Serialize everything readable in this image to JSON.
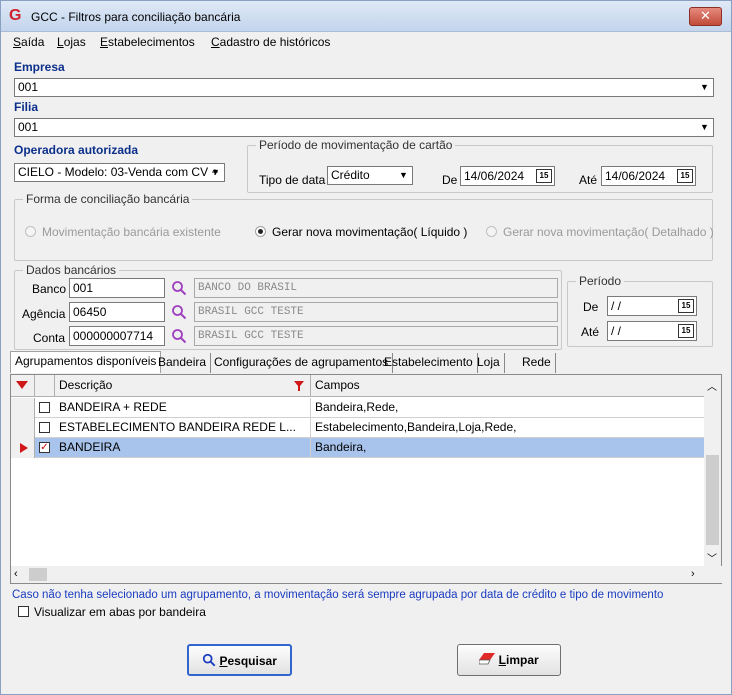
{
  "window": {
    "title": "GCC - Filtros para conciliação bancária",
    "close_label": "✕"
  },
  "menu": {
    "items": [
      {
        "accel": "S",
        "rest": "aída"
      },
      {
        "accel": "L",
        "rest": "ojas"
      },
      {
        "accel": "E",
        "rest": "stabelecimentos"
      },
      {
        "accel": "C",
        "rest": "adastro de históricos"
      }
    ]
  },
  "empresa": {
    "label": "Empresa",
    "value": "001"
  },
  "filial": {
    "label": "Filia",
    "value": "001"
  },
  "operadora": {
    "label": "Operadora autorizada",
    "value": "CIELO - Modelo: 03-Venda com CV +"
  },
  "periodo_cartao": {
    "title": "Período de movimentação de cartão",
    "tipo_label": "Tipo de data",
    "tipo_value": "Crédito",
    "de_label": "De",
    "de_value": "14/06/2024",
    "ate_label": "Até",
    "ate_value": "14/06/2024",
    "cal_glyph": "15"
  },
  "forma": {
    "title": "Forma de conciliação bancária",
    "options": [
      {
        "label": "Movimentação bancária existente",
        "checked": false,
        "enabled": false
      },
      {
        "label": "Gerar nova movimentação( Líquido )",
        "checked": true,
        "enabled": true
      },
      {
        "label": "Gerar nova movimentação( Detalhado )",
        "checked": false,
        "enabled": false
      }
    ]
  },
  "dados_bancarios": {
    "title": "Dados bancários",
    "banco_label": "Banco",
    "banco_value": "001",
    "banco_desc": "BANCO DO BRASIL",
    "agencia_label": "Agência",
    "agencia_value": "06450",
    "agencia_desc": "BRASIL GCC TESTE",
    "conta_label": "Conta",
    "conta_value": "000000007714",
    "conta_desc": "BRASIL GCC TESTE"
  },
  "periodo": {
    "title": "Período",
    "de_label": "De",
    "de_value": " / /",
    "ate_label": "Até",
    "ate_value": " / /"
  },
  "tabs": [
    "Agrupamentos disponíveis",
    "Bandeira",
    "Configurações de agrupamentos",
    "Estabelecimento",
    "Loja",
    "Rede"
  ],
  "grid": {
    "col_descricao": "Descrição",
    "col_campos": "Campos",
    "rows": [
      {
        "descricao": "BANDEIRA + REDE",
        "campos": "Bandeira,Rede,",
        "checked": false,
        "selected": false
      },
      {
        "descricao": "ESTABELECIMENTO BANDEIRA REDE L...",
        "campos": "Estabelecimento,Bandeira,Loja,Rede,",
        "checked": false,
        "selected": false
      },
      {
        "descricao": "BANDEIRA",
        "campos": "Bandeira,",
        "checked": true,
        "selected": true
      }
    ]
  },
  "info_text": "Caso não tenha selecionado um agrupamento,  a movimentação será sempre agrupada por data de crédito e tipo de movimento",
  "visualizar_label": "Visualizar em abas por bandeira",
  "buttons": {
    "pesquisar_accel": "P",
    "pesquisar_rest": "esquisar",
    "limpar_accel": "L",
    "limpar_rest": "impar"
  },
  "colors": {
    "label_blue": "#0b2f8a",
    "info_blue": "#1a3cc0",
    "selection": "#a8c4ec",
    "indicator_red": "#d01818"
  }
}
